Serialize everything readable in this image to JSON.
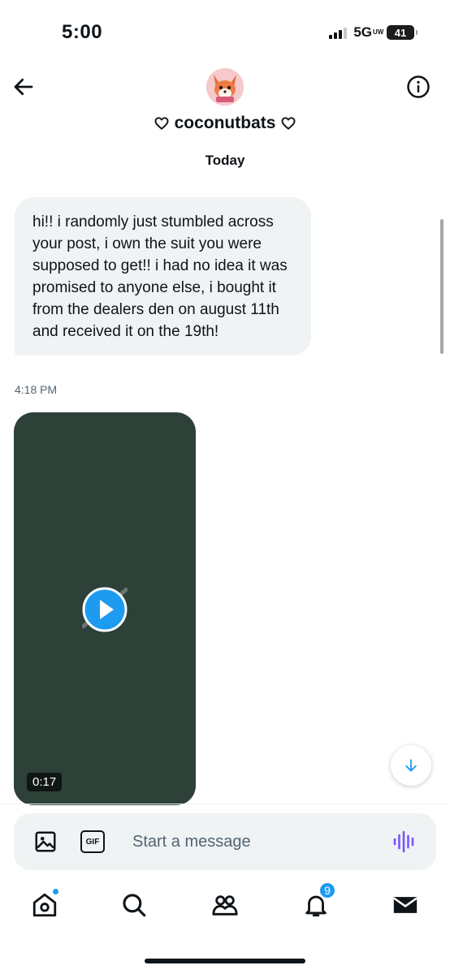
{
  "status_bar": {
    "time": "5:00",
    "network": "5G",
    "network_suffix": "UW",
    "battery": "41"
  },
  "header": {
    "title": "coconutbats",
    "title_decoration_icon": "heart-outline-icon",
    "back_icon": "arrow-left-icon",
    "info_icon": "info-circle-icon"
  },
  "conversation": {
    "date_separator": "Today",
    "messages": [
      {
        "type": "text",
        "text": "hi!! i randomly just stumbled across your post, i own the suit you were supposed to get!! i had no idea it was promised to anyone else, i bought it from the dealers den on august 11th and received it on the 19th!",
        "timestamp": "4:18 PM"
      },
      {
        "type": "video",
        "duration": "0:17"
      }
    ]
  },
  "composer": {
    "placeholder": "Start a message",
    "media_icon": "image-icon",
    "gif_label": "GIF",
    "voice_icon": "voice-wave-icon"
  },
  "tab_bar": {
    "items": [
      {
        "name": "home",
        "icon": "home-icon",
        "has_dot": true
      },
      {
        "name": "search",
        "icon": "search-icon"
      },
      {
        "name": "communities",
        "icon": "people-icon"
      },
      {
        "name": "notifications",
        "icon": "bell-icon",
        "badge": "9"
      },
      {
        "name": "messages",
        "icon": "envelope-icon",
        "active": true
      }
    ]
  },
  "colors": {
    "accent": "#1d9bf0",
    "bubble": "#eff3f4",
    "video_bg": "#2d4138",
    "voice": "#7856ff"
  }
}
